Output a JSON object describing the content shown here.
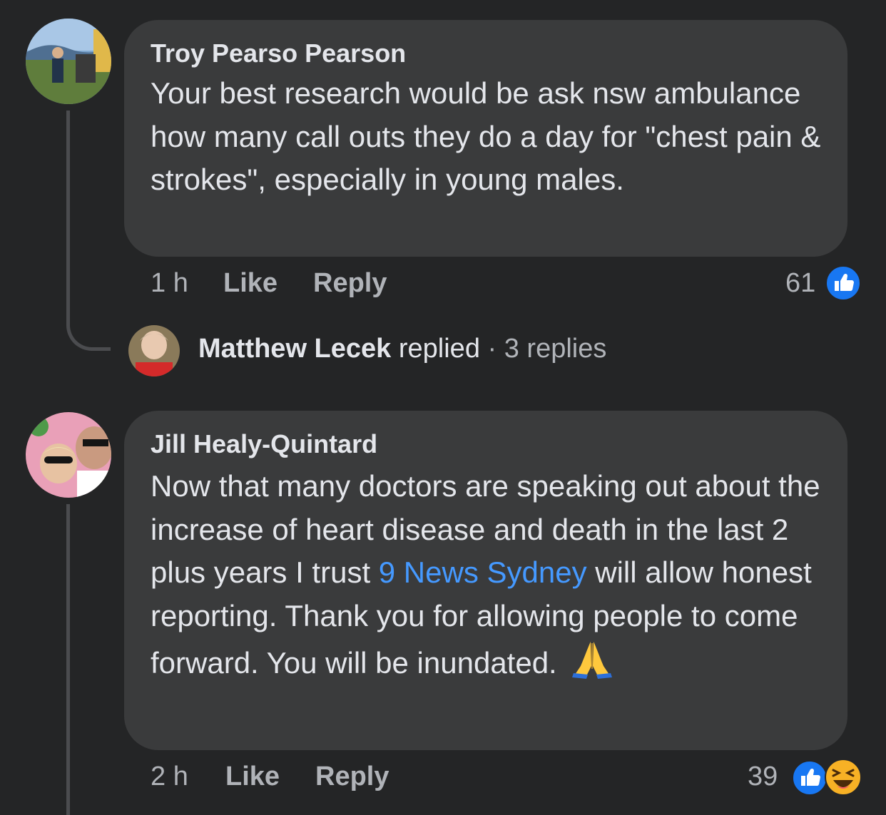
{
  "comments": [
    {
      "author": "Troy Pearso Pearson",
      "text": "Your best research would be ask nsw ambulance how many call outs they do a day for \"chest pain & strokes\", especially in young males.",
      "time": "1 h",
      "like_label": "Like",
      "reply_label": "Reply",
      "reaction_count": "61",
      "reactions": [
        "like-icon"
      ]
    },
    {
      "author": "Jill Healy-Quintard",
      "text_before": "Now that many doctors are speaking out about the increase of heart disease and death in the last 2 plus years I trust ",
      "mention": "9 News Sydney",
      "text_after": " will allow honest reporting. Thank you for allowing people to come forward. You will be inundated.",
      "emoji": "folded-hands-icon",
      "time": "2 h",
      "like_label": "Like",
      "reply_label": "Reply",
      "reaction_count": "39",
      "reactions": [
        "like-icon",
        "laughing-icon"
      ]
    }
  ],
  "reply_summary": {
    "name": "Matthew Lecek",
    "action": "replied",
    "separator": "·",
    "count": "3 replies"
  },
  "colors": {
    "background": "#242526",
    "bubble": "#3a3b3c",
    "text": "#e4e6eb",
    "secondary": "#b0b3b8",
    "mention": "#4599ff",
    "like_blue": "#1877f2"
  }
}
